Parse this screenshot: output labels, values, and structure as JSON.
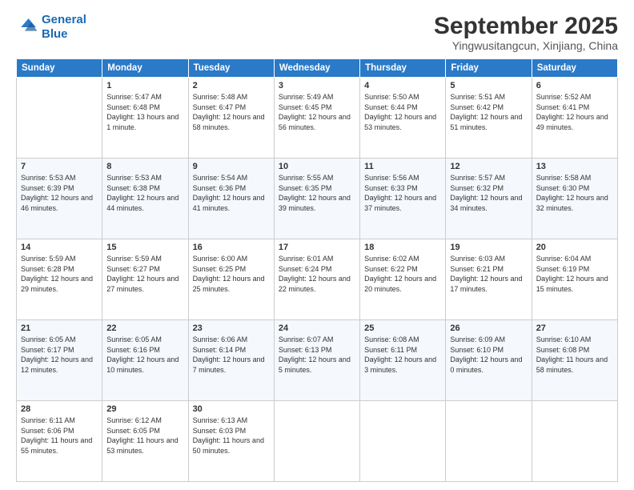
{
  "logo": {
    "line1": "General",
    "line2": "Blue"
  },
  "title": "September 2025",
  "location": "Yingwusitangcun, Xinjiang, China",
  "days_of_week": [
    "Sunday",
    "Monday",
    "Tuesday",
    "Wednesday",
    "Thursday",
    "Friday",
    "Saturday"
  ],
  "weeks": [
    [
      {
        "day": "",
        "sunrise": "",
        "sunset": "",
        "daylight": ""
      },
      {
        "day": "1",
        "sunrise": "Sunrise: 5:47 AM",
        "sunset": "Sunset: 6:48 PM",
        "daylight": "Daylight: 13 hours and 1 minute."
      },
      {
        "day": "2",
        "sunrise": "Sunrise: 5:48 AM",
        "sunset": "Sunset: 6:47 PM",
        "daylight": "Daylight: 12 hours and 58 minutes."
      },
      {
        "day": "3",
        "sunrise": "Sunrise: 5:49 AM",
        "sunset": "Sunset: 6:45 PM",
        "daylight": "Daylight: 12 hours and 56 minutes."
      },
      {
        "day": "4",
        "sunrise": "Sunrise: 5:50 AM",
        "sunset": "Sunset: 6:44 PM",
        "daylight": "Daylight: 12 hours and 53 minutes."
      },
      {
        "day": "5",
        "sunrise": "Sunrise: 5:51 AM",
        "sunset": "Sunset: 6:42 PM",
        "daylight": "Daylight: 12 hours and 51 minutes."
      },
      {
        "day": "6",
        "sunrise": "Sunrise: 5:52 AM",
        "sunset": "Sunset: 6:41 PM",
        "daylight": "Daylight: 12 hours and 49 minutes."
      }
    ],
    [
      {
        "day": "7",
        "sunrise": "Sunrise: 5:53 AM",
        "sunset": "Sunset: 6:39 PM",
        "daylight": "Daylight: 12 hours and 46 minutes."
      },
      {
        "day": "8",
        "sunrise": "Sunrise: 5:53 AM",
        "sunset": "Sunset: 6:38 PM",
        "daylight": "Daylight: 12 hours and 44 minutes."
      },
      {
        "day": "9",
        "sunrise": "Sunrise: 5:54 AM",
        "sunset": "Sunset: 6:36 PM",
        "daylight": "Daylight: 12 hours and 41 minutes."
      },
      {
        "day": "10",
        "sunrise": "Sunrise: 5:55 AM",
        "sunset": "Sunset: 6:35 PM",
        "daylight": "Daylight: 12 hours and 39 minutes."
      },
      {
        "day": "11",
        "sunrise": "Sunrise: 5:56 AM",
        "sunset": "Sunset: 6:33 PM",
        "daylight": "Daylight: 12 hours and 37 minutes."
      },
      {
        "day": "12",
        "sunrise": "Sunrise: 5:57 AM",
        "sunset": "Sunset: 6:32 PM",
        "daylight": "Daylight: 12 hours and 34 minutes."
      },
      {
        "day": "13",
        "sunrise": "Sunrise: 5:58 AM",
        "sunset": "Sunset: 6:30 PM",
        "daylight": "Daylight: 12 hours and 32 minutes."
      }
    ],
    [
      {
        "day": "14",
        "sunrise": "Sunrise: 5:59 AM",
        "sunset": "Sunset: 6:28 PM",
        "daylight": "Daylight: 12 hours and 29 minutes."
      },
      {
        "day": "15",
        "sunrise": "Sunrise: 5:59 AM",
        "sunset": "Sunset: 6:27 PM",
        "daylight": "Daylight: 12 hours and 27 minutes."
      },
      {
        "day": "16",
        "sunrise": "Sunrise: 6:00 AM",
        "sunset": "Sunset: 6:25 PM",
        "daylight": "Daylight: 12 hours and 25 minutes."
      },
      {
        "day": "17",
        "sunrise": "Sunrise: 6:01 AM",
        "sunset": "Sunset: 6:24 PM",
        "daylight": "Daylight: 12 hours and 22 minutes."
      },
      {
        "day": "18",
        "sunrise": "Sunrise: 6:02 AM",
        "sunset": "Sunset: 6:22 PM",
        "daylight": "Daylight: 12 hours and 20 minutes."
      },
      {
        "day": "19",
        "sunrise": "Sunrise: 6:03 AM",
        "sunset": "Sunset: 6:21 PM",
        "daylight": "Daylight: 12 hours and 17 minutes."
      },
      {
        "day": "20",
        "sunrise": "Sunrise: 6:04 AM",
        "sunset": "Sunset: 6:19 PM",
        "daylight": "Daylight: 12 hours and 15 minutes."
      }
    ],
    [
      {
        "day": "21",
        "sunrise": "Sunrise: 6:05 AM",
        "sunset": "Sunset: 6:17 PM",
        "daylight": "Daylight: 12 hours and 12 minutes."
      },
      {
        "day": "22",
        "sunrise": "Sunrise: 6:05 AM",
        "sunset": "Sunset: 6:16 PM",
        "daylight": "Daylight: 12 hours and 10 minutes."
      },
      {
        "day": "23",
        "sunrise": "Sunrise: 6:06 AM",
        "sunset": "Sunset: 6:14 PM",
        "daylight": "Daylight: 12 hours and 7 minutes."
      },
      {
        "day": "24",
        "sunrise": "Sunrise: 6:07 AM",
        "sunset": "Sunset: 6:13 PM",
        "daylight": "Daylight: 12 hours and 5 minutes."
      },
      {
        "day": "25",
        "sunrise": "Sunrise: 6:08 AM",
        "sunset": "Sunset: 6:11 PM",
        "daylight": "Daylight: 12 hours and 3 minutes."
      },
      {
        "day": "26",
        "sunrise": "Sunrise: 6:09 AM",
        "sunset": "Sunset: 6:10 PM",
        "daylight": "Daylight: 12 hours and 0 minutes."
      },
      {
        "day": "27",
        "sunrise": "Sunrise: 6:10 AM",
        "sunset": "Sunset: 6:08 PM",
        "daylight": "Daylight: 11 hours and 58 minutes."
      }
    ],
    [
      {
        "day": "28",
        "sunrise": "Sunrise: 6:11 AM",
        "sunset": "Sunset: 6:06 PM",
        "daylight": "Daylight: 11 hours and 55 minutes."
      },
      {
        "day": "29",
        "sunrise": "Sunrise: 6:12 AM",
        "sunset": "Sunset: 6:05 PM",
        "daylight": "Daylight: 11 hours and 53 minutes."
      },
      {
        "day": "30",
        "sunrise": "Sunrise: 6:13 AM",
        "sunset": "Sunset: 6:03 PM",
        "daylight": "Daylight: 11 hours and 50 minutes."
      },
      {
        "day": "",
        "sunrise": "",
        "sunset": "",
        "daylight": ""
      },
      {
        "day": "",
        "sunrise": "",
        "sunset": "",
        "daylight": ""
      },
      {
        "day": "",
        "sunrise": "",
        "sunset": "",
        "daylight": ""
      },
      {
        "day": "",
        "sunrise": "",
        "sunset": "",
        "daylight": ""
      }
    ]
  ]
}
